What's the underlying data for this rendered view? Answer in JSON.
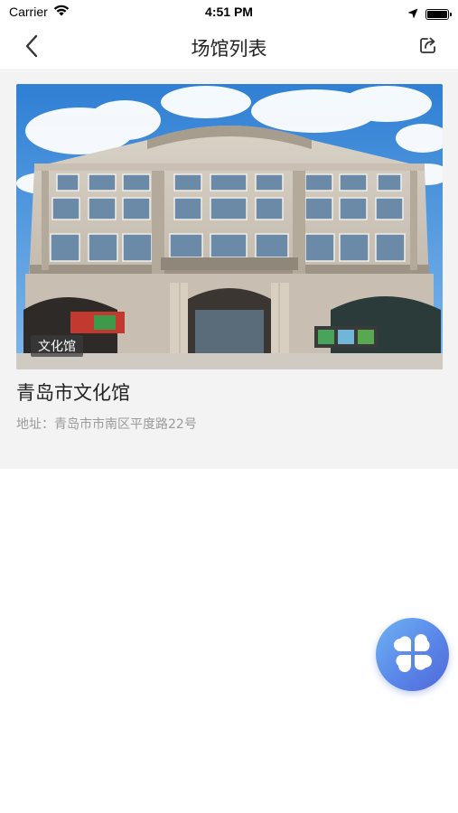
{
  "status_bar": {
    "carrier": "Carrier",
    "time": "4:51 PM",
    "battery_level": 1.0
  },
  "nav": {
    "title": "场馆列表",
    "back_icon": "chevron-left-icon",
    "share_icon": "share-icon"
  },
  "venues": [
    {
      "tag": "文化馆",
      "name": "青岛市文化馆",
      "address": "地址：青岛市市南区平度路22号"
    }
  ],
  "fab": {
    "icon": "four-petal-menu-icon"
  },
  "colors": {
    "background": "#ffffff",
    "list_background": "#f3f3f3",
    "fab_gradient_start": "#6eb3f3",
    "fab_gradient_end": "#5068d8",
    "address_text": "#9a9a9a"
  }
}
